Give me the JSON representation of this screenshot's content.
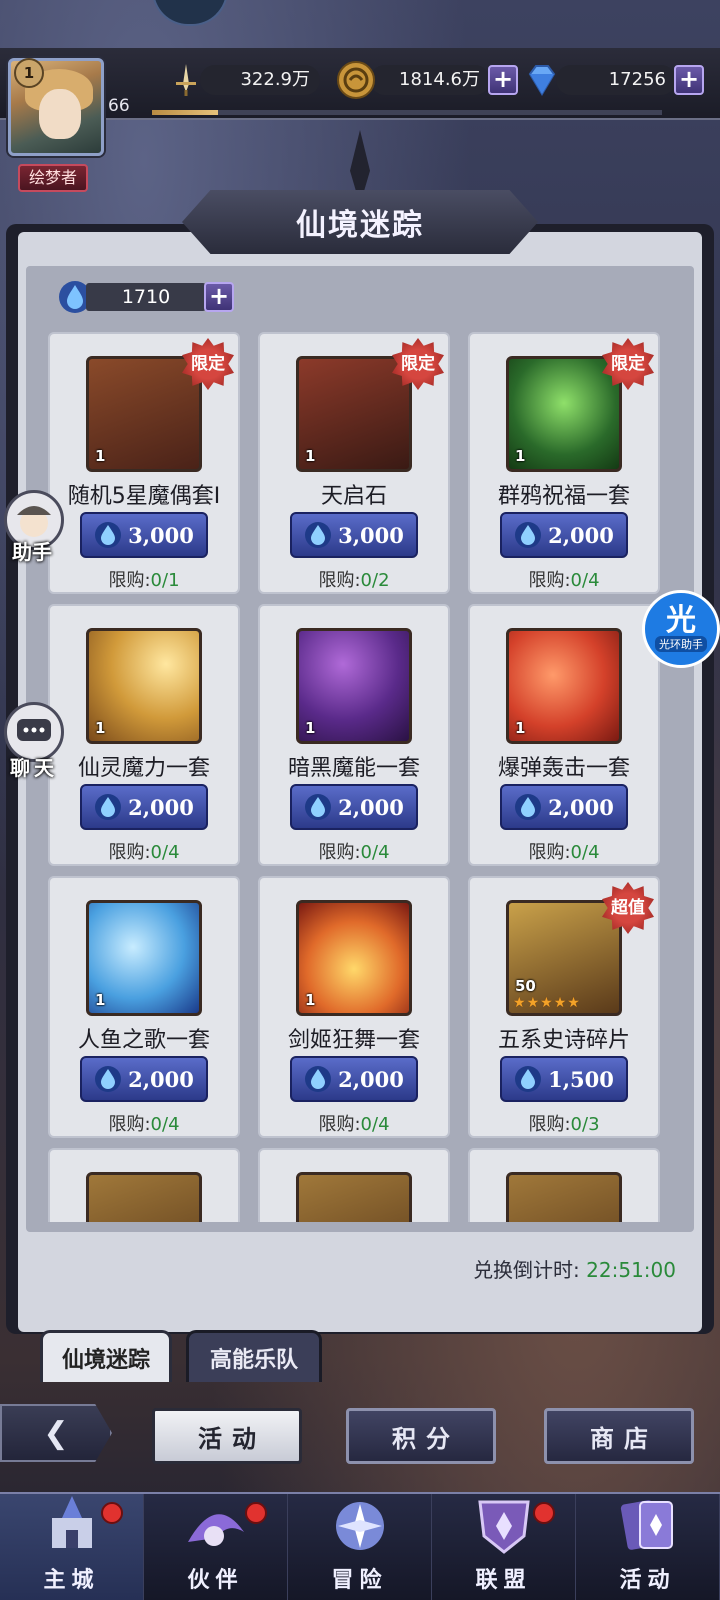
{
  "player": {
    "rank": "1",
    "level": "66",
    "title": "绘梦者",
    "exp_fraction": 0.13
  },
  "resources": {
    "power": "322.9万",
    "gold": "1814.6万",
    "gems": "17256",
    "plus_symbol": "+"
  },
  "panel": {
    "title": "仙境迷踪",
    "currency_value": "1710",
    "countdown_label": "兑换倒计时:",
    "countdown_value": "22:51:00"
  },
  "items": [
    {
      "name": "随机5星魔偶套I",
      "price": "3,000",
      "limit_label": "限购:",
      "limit": "0/1",
      "tag": "限定",
      "qty": "1",
      "art": "box"
    },
    {
      "name": "天启石",
      "price": "3,000",
      "limit_label": "限购:",
      "limit": "0/2",
      "tag": "限定",
      "qty": "1",
      "art": "stone"
    },
    {
      "name": "群鸦祝福一套",
      "price": "2,000",
      "limit_label": "限购:",
      "limit": "0/4",
      "tag": "限定",
      "qty": "1",
      "art": "green"
    },
    {
      "name": "仙灵魔力一套",
      "price": "2,000",
      "limit_label": "限购:",
      "limit": "0/4",
      "tag": "",
      "qty": "1",
      "art": "gold"
    },
    {
      "name": "暗黑魔能一套",
      "price": "2,000",
      "limit_label": "限购:",
      "limit": "0/4",
      "tag": "",
      "qty": "1",
      "art": "purple"
    },
    {
      "name": "爆弹轰击一套",
      "price": "2,000",
      "limit_label": "限购:",
      "limit": "0/4",
      "tag": "",
      "qty": "1",
      "art": "red"
    },
    {
      "name": "人鱼之歌一套",
      "price": "2,000",
      "limit_label": "限购:",
      "limit": "0/4",
      "tag": "",
      "qty": "1",
      "art": "blue"
    },
    {
      "name": "剑姬狂舞一套",
      "price": "2,000",
      "limit_label": "限购:",
      "limit": "0/4",
      "tag": "",
      "qty": "1",
      "art": "fire"
    },
    {
      "name": "五系史诗碎片",
      "price": "1,500",
      "limit_label": "限购:",
      "limit": "0/3",
      "tag": "超值",
      "qty": "50",
      "art": "chest"
    }
  ],
  "tabs": {
    "active": "仙境迷踪",
    "inactive": "高能乐队"
  },
  "actions": {
    "activity": "活动",
    "points": "积分",
    "shop": "商店"
  },
  "side": {
    "assistant": "助手",
    "chat": "聊天",
    "helper_big": "光",
    "helper_small": "光环助手"
  },
  "nav": [
    {
      "label": "主城",
      "dot": true
    },
    {
      "label": "伙伴",
      "dot": true
    },
    {
      "label": "冒险",
      "dot": false
    },
    {
      "label": "联盟",
      "dot": true
    },
    {
      "label": "活动",
      "dot": false
    }
  ],
  "colors": {
    "accent_green": "#2a8a3a",
    "price_blue": "#3b4ba8",
    "tag_red": "#c8352f"
  }
}
